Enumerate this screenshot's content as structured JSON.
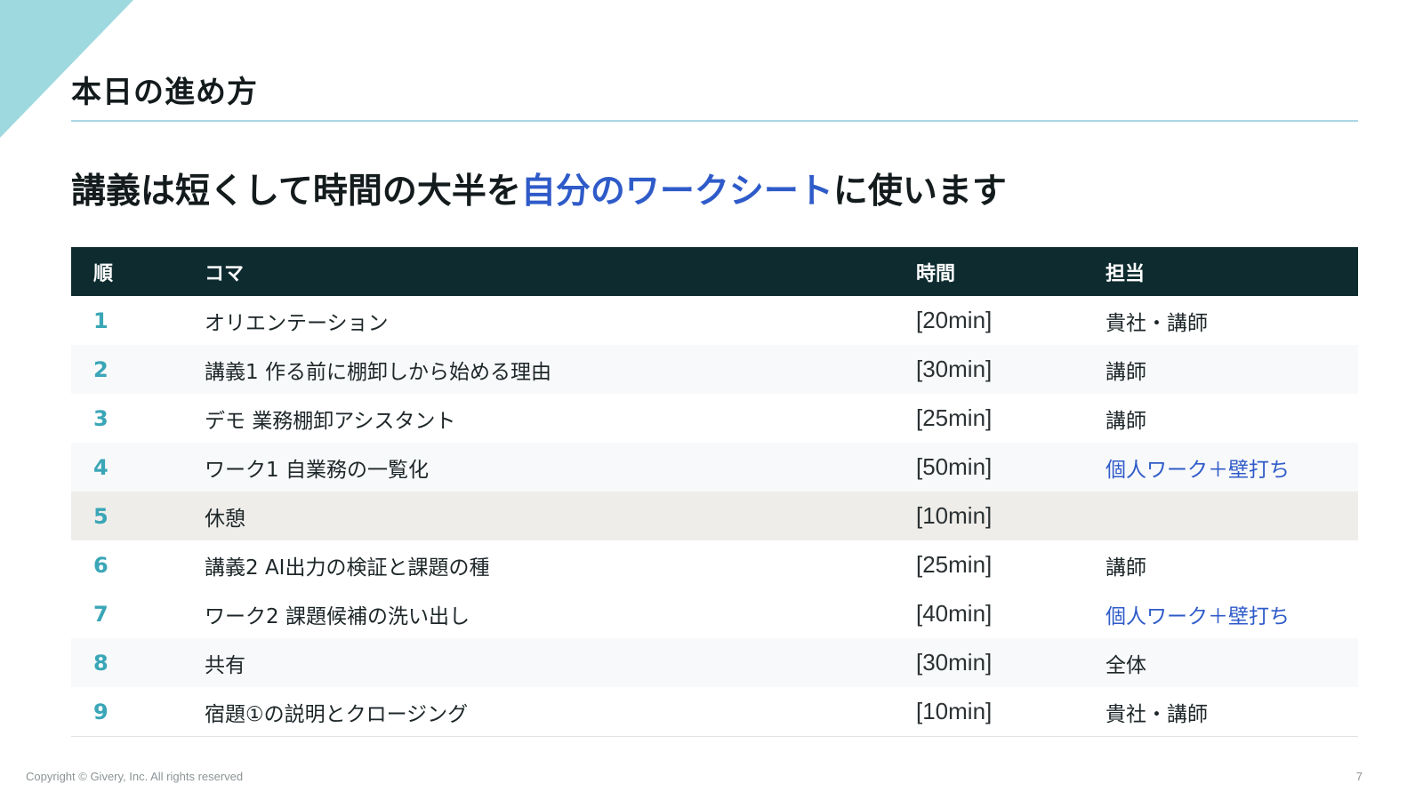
{
  "slide": {
    "title": "本日の進め方",
    "headline_before": "講義は短くして時間の大半を",
    "headline_highlight": "自分のワークシート",
    "headline_after": "に使います",
    "accent_color": "#2f5bc9",
    "header_bg_color": "#0e2c30"
  },
  "table": {
    "headers": {
      "order": "順",
      "koma": "コマ",
      "time": "時間",
      "owner": "担当"
    },
    "rows": [
      {
        "order": "1",
        "koma": "オリエンテーション",
        "time": "[20min]",
        "owner": "貴社・講師"
      },
      {
        "order": "2",
        "koma": "講義1 作る前に棚卸しから始める理由",
        "time": "[30min]",
        "owner": "講師"
      },
      {
        "order": "3",
        "koma": "デモ 業務棚卸アシスタント",
        "time": "[25min]",
        "owner": "講師"
      },
      {
        "order": "4",
        "koma": "ワーク1 自業務の一覧化",
        "time": "[50min]",
        "owner": "個人ワーク＋壁打ち"
      },
      {
        "order": "5",
        "koma": "休憩",
        "time": "[10min]",
        "owner": ""
      },
      {
        "order": "6",
        "koma": "講義2 AI出力の検証と課題の種",
        "time": "[25min]",
        "owner": "講師"
      },
      {
        "order": "7",
        "koma": "ワーク2 課題候補の洗い出し",
        "time": "[40min]",
        "owner": "個人ワーク＋壁打ち"
      },
      {
        "order": "8",
        "koma": "共有",
        "time": "[30min]",
        "owner": "全体"
      },
      {
        "order": "9",
        "koma": "宿題①の説明とクロージング",
        "time": "[10min]",
        "owner": "貴社・講師"
      }
    ]
  },
  "footer": {
    "copyright": "Copyright © Givery, Inc. All rights reserved",
    "page_number": "7"
  }
}
